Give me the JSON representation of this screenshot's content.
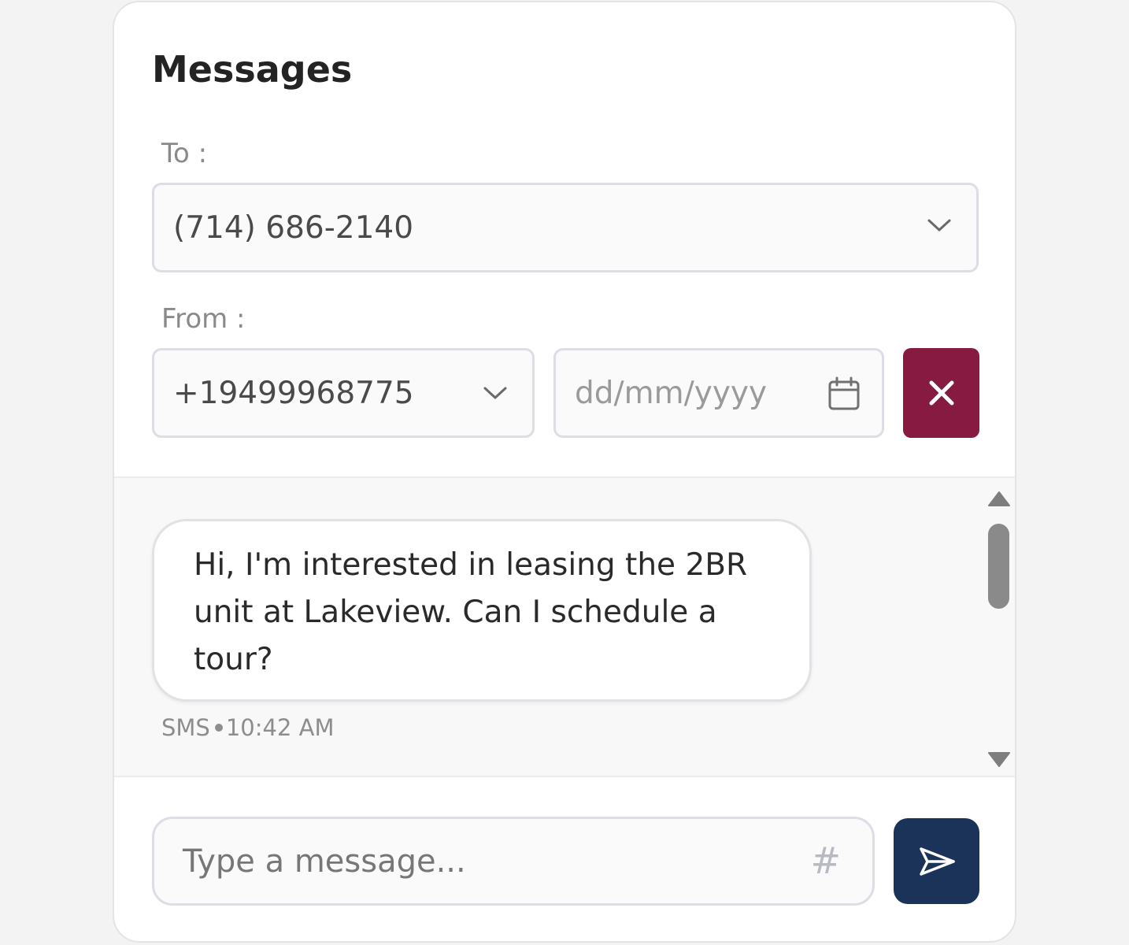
{
  "header": {
    "title": "Messages"
  },
  "to": {
    "label": "To :",
    "value": "(714) 686-2140"
  },
  "from": {
    "label": "From :",
    "number": "+19499968775",
    "date_placeholder": "dd/mm/yyyy"
  },
  "thread": {
    "messages": [
      {
        "text": "Hi, I'm interested in leasing the 2BR unit at Lakeview. Can I schedule a tour?",
        "channel": "SMS",
        "time": "10:42 AM"
      }
    ]
  },
  "composer": {
    "placeholder": "Type a message...",
    "hash_symbol": "#"
  },
  "icons": {
    "to_dropdown": "chevron-down-icon",
    "from_dropdown": "chevron-down-icon",
    "date": "calendar-icon",
    "clear": "close-icon",
    "send": "send-icon"
  },
  "colors": {
    "clear_button": "#861a41",
    "send_button": "#1b3358",
    "panel_border": "#e3e3ea"
  }
}
